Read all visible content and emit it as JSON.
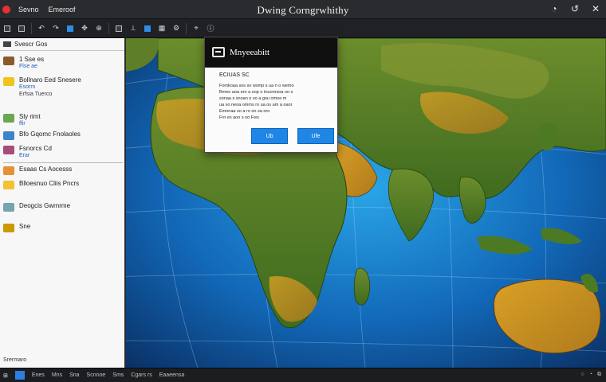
{
  "window": {
    "title": "Dwing Corngrwhithy",
    "menu": [
      "Sevno",
      "Emeroof"
    ],
    "controls": [
      "◔",
      "↺",
      "✕"
    ]
  },
  "toolbar": {
    "search_placeholder": "",
    "buttons": [
      "undo-icon",
      "redo-icon",
      "zoom-in-icon",
      "pan-icon",
      "select-icon",
      "layers-icon",
      "settings-icon"
    ]
  },
  "sidebar": {
    "header": "Svescr Gos",
    "layers": [
      {
        "name": "1 Sse es",
        "sub": "Flse ae",
        "color": "#8b5a2b"
      },
      {
        "name": "Bollnaro Eed Snesere",
        "sub": "Esorm",
        "extra": "Erfsia Tuerco",
        "color": "#f0c419"
      },
      {
        "name": "Sly rimt",
        "sub": "ffir",
        "color": "#6aa84f"
      },
      {
        "name": "Bfo Gqomc Fnolaoles",
        "sub": "",
        "color": "#3d85c6"
      },
      {
        "name": "Fsnorcs Cd",
        "sub": "Erar",
        "color": "#a64d79"
      },
      {
        "name": "Esaas Cs Aocesss",
        "sub": "",
        "color": "#e69138"
      },
      {
        "name": "Blloesnuo Cliis Pncrs",
        "sub": "",
        "color": "#f1c232"
      },
      {
        "name": "Deogcis Gwrnrme",
        "sub": "",
        "color": "#76a5af"
      },
      {
        "name": "Sne",
        "sub": "",
        "color": "#cc9900"
      }
    ],
    "footer": "Srermaro"
  },
  "dialog": {
    "title": "Mnyeeabitt",
    "heading": "ECIUAS SC",
    "lines": [
      "Fomkoaa sos so wsmp s ua n o wemo",
      "Bmeo aoa ero a oop o tnuonrsoa oo s",
      "sonaa s snoan o so a gou omoe m",
      "ua so neoa omms ro ua os am a oaor",
      "Emonaa so a ro on sa oro",
      "Frn es aoo s oo Fws"
    ],
    "buttons": [
      "Ub",
      "Ufe"
    ]
  },
  "status": {
    "items": [
      "Enes",
      "Mns",
      "Sna",
      "Scnnoe",
      "Sms",
      "Cgars rs",
      "Eaaeensa"
    ],
    "right": [
      "○",
      "◔",
      "⧉"
    ]
  }
}
